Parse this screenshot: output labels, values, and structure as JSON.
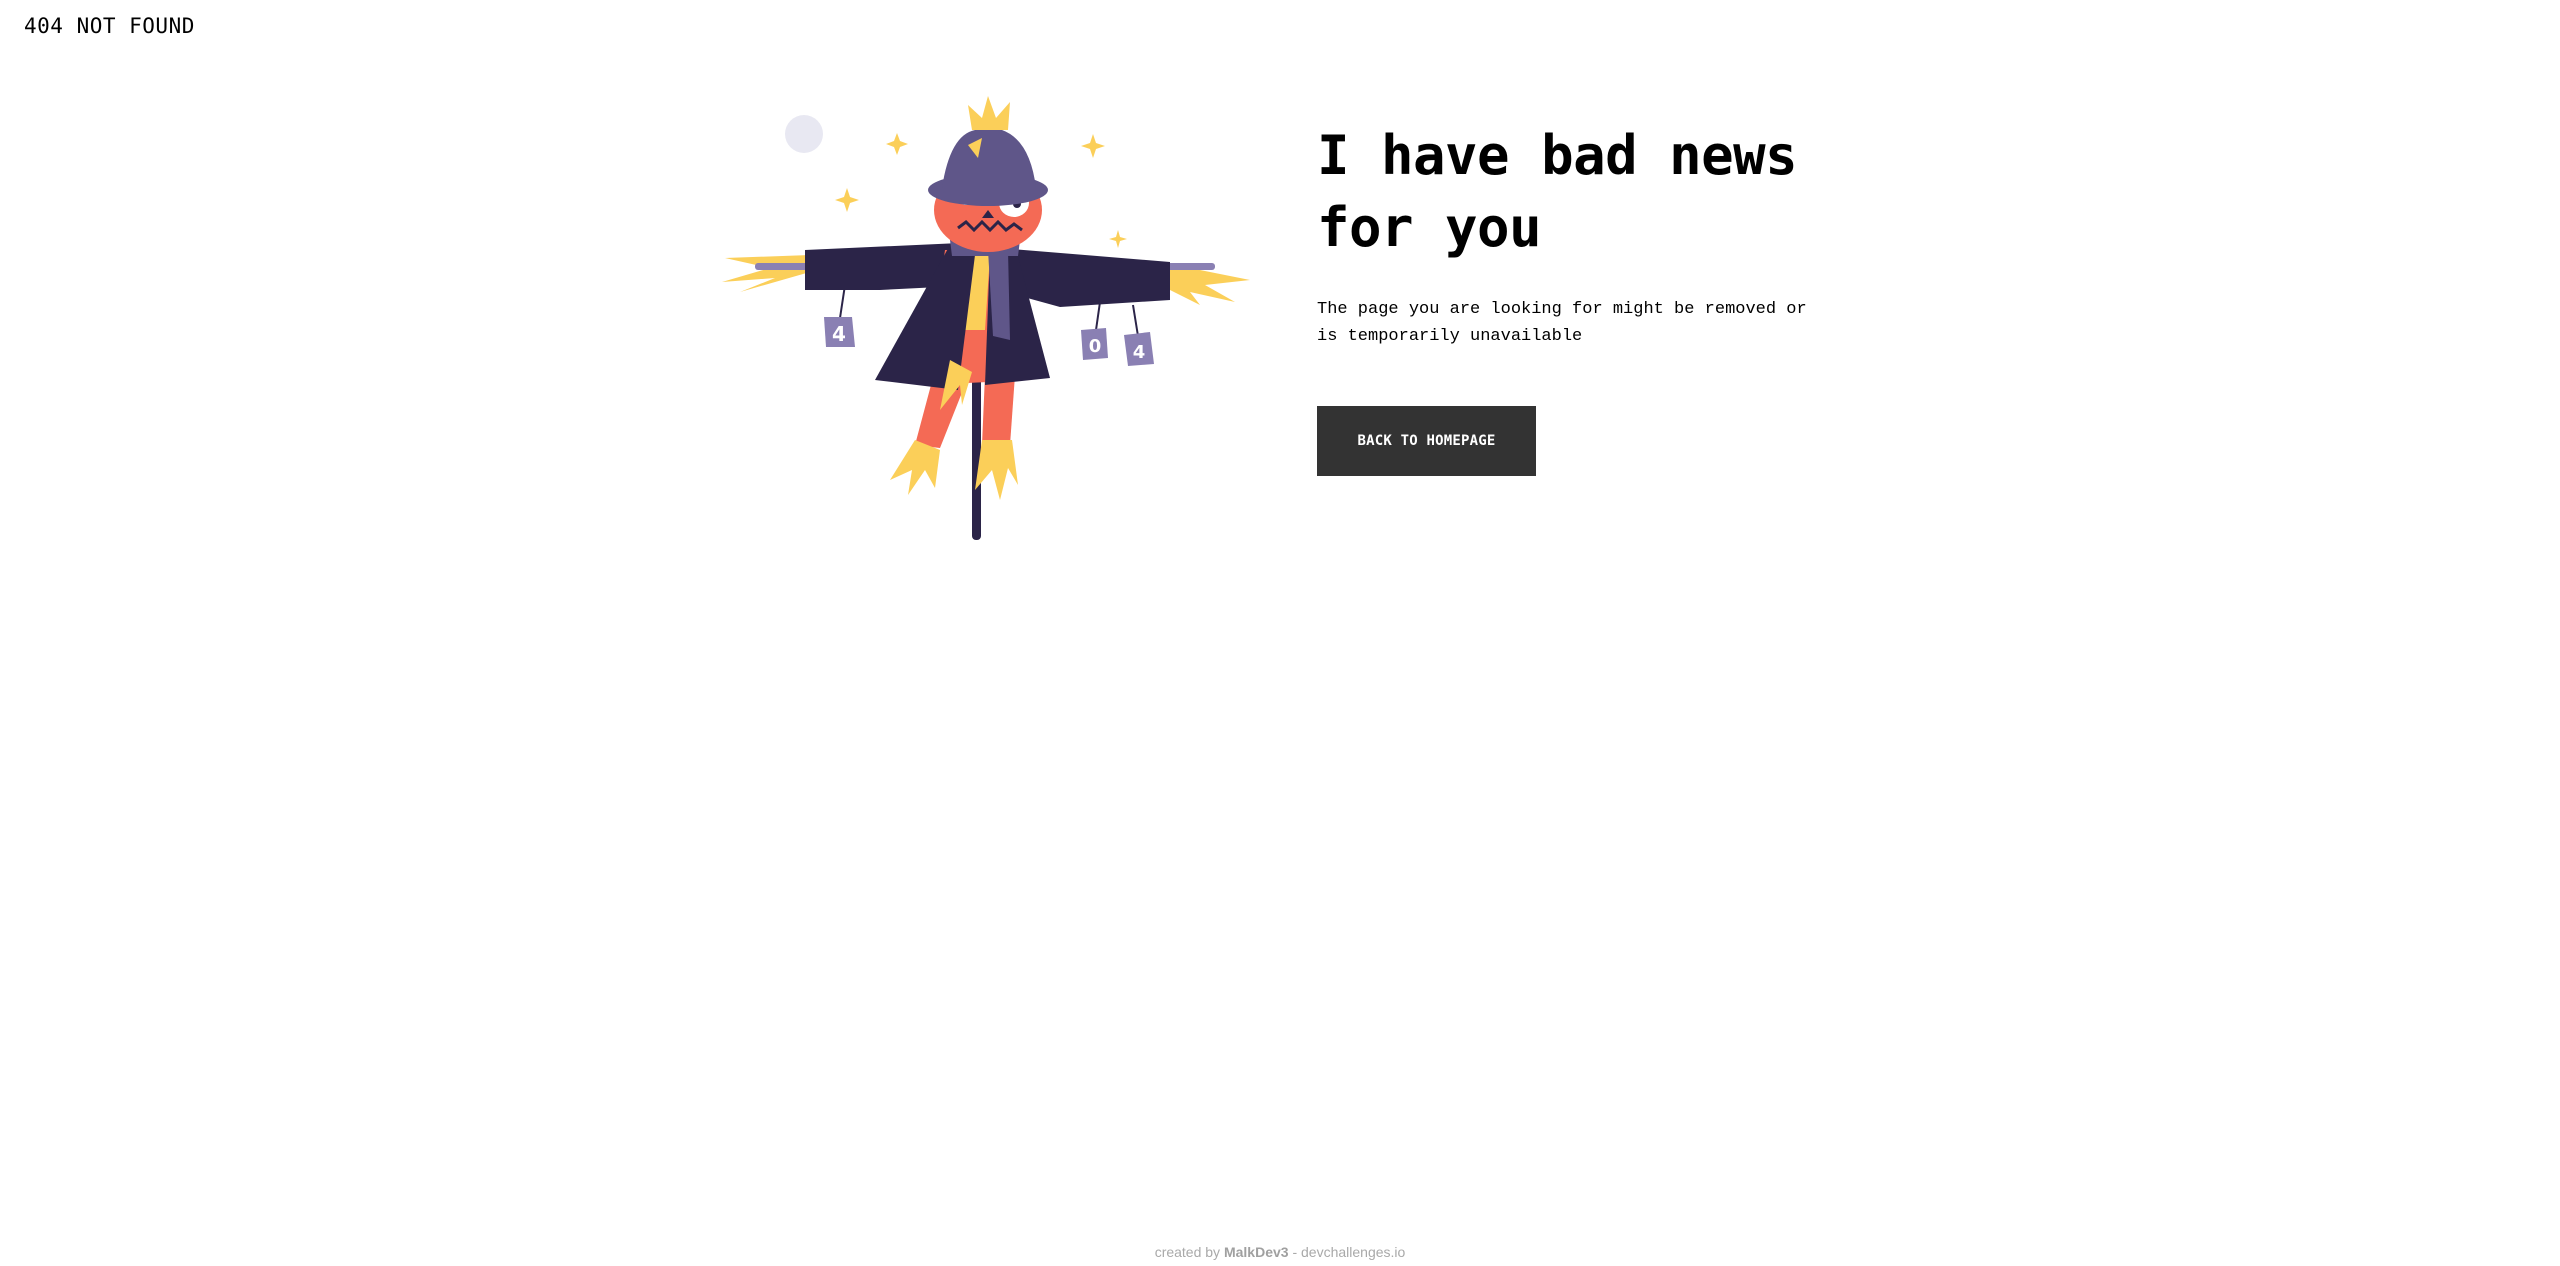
{
  "site": {
    "label": "404 NOT FOUND"
  },
  "main": {
    "headline_line1": "I have bad news",
    "headline_line2": "for you",
    "description": "The page you are looking for might be removed or is temporarily unavailable",
    "cta_label": "BACK TO HOMEPAGE"
  },
  "illustration": {
    "cans": [
      "4",
      "0",
      "4"
    ],
    "colors": {
      "coat": "#2b2448",
      "hat": "#5f5689",
      "face": "#f46a55",
      "straw": "#fbcf59",
      "moon": "#e8e8f2",
      "can": "#8a80b3"
    }
  },
  "footer": {
    "prefix": "created by",
    "author": "MalkDev3",
    "separator": "-",
    "site": "devchallenges.io"
  }
}
